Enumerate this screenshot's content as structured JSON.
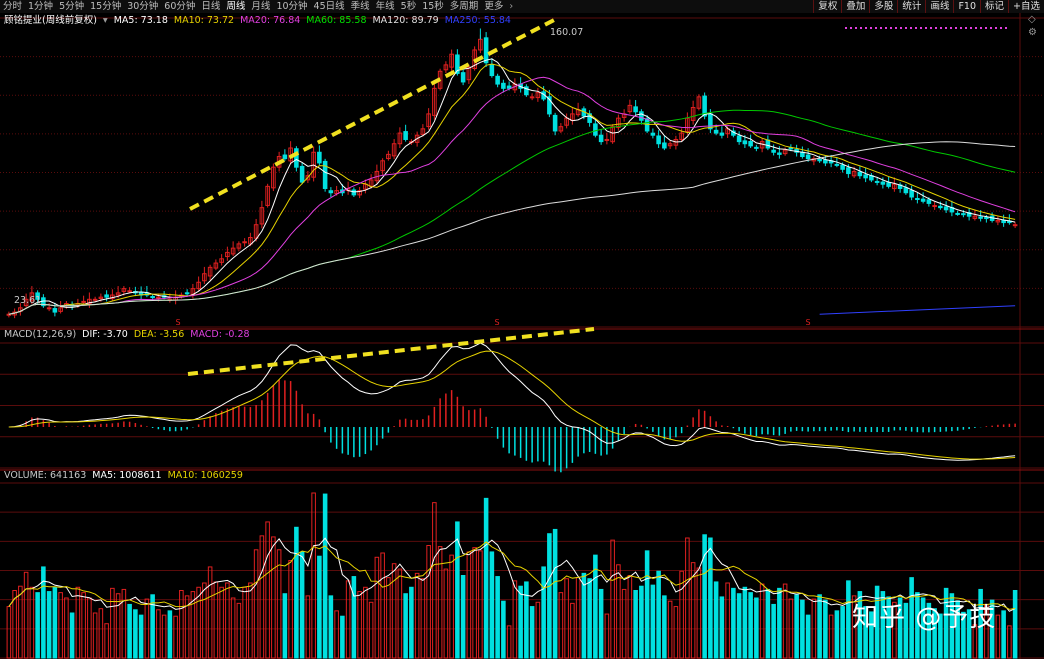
{
  "toolbar": {
    "tabs": [
      {
        "label": "分时"
      },
      {
        "label": "1分钟"
      },
      {
        "label": "5分钟"
      },
      {
        "label": "15分钟"
      },
      {
        "label": "30分钟"
      },
      {
        "label": "60分钟"
      },
      {
        "label": "日线"
      },
      {
        "label": "周线",
        "active": true
      },
      {
        "label": "月线"
      },
      {
        "label": "10分钟"
      },
      {
        "label": "45日线"
      },
      {
        "label": "季线"
      },
      {
        "label": "年线"
      },
      {
        "label": "5秒"
      },
      {
        "label": "15秒"
      },
      {
        "label": "多周期"
      },
      {
        "label": "更多"
      }
    ],
    "more_icon": "chevron-right-icon",
    "right_buttons": [
      {
        "label": "复权"
      },
      {
        "label": "叠加"
      },
      {
        "label": "多股"
      },
      {
        "label": "统计"
      },
      {
        "label": "画线"
      },
      {
        "label": "F10"
      },
      {
        "label": "标记"
      },
      {
        "label": "+自选"
      }
    ]
  },
  "price_panel": {
    "stock_name": "顾铭提业(周线前复权)",
    "ma_legend": [
      {
        "label": "MA5: 73.18",
        "color": "#ffffff"
      },
      {
        "label": "MA10: 73.72",
        "color": "#e6d200"
      },
      {
        "label": "MA20: 76.84",
        "color": "#e040e0"
      },
      {
        "label": "MA60: 85.58",
        "color": "#00e000"
      },
      {
        "label": "MA120: 89.79",
        "color": "#e0e0e0"
      },
      {
        "label": "MA250: 55.84",
        "color": "#3040ff"
      }
    ],
    "high_label": "160.07",
    "low_label": "23.61",
    "settings_icon": "gear-icon",
    "expand_icon": "diamond-icon"
  },
  "macd_panel": {
    "legend": [
      {
        "label": "MACD(12,26,9)",
        "color": "#c8c8c8"
      },
      {
        "label": "DIF: -3.70",
        "color": "#ffffff"
      },
      {
        "label": "DEA: -3.56",
        "color": "#e6d200"
      },
      {
        "label": "MACD: -0.28",
        "color": "#e040e0"
      }
    ]
  },
  "volume_panel": {
    "legend": [
      {
        "label": "VOLUME: 641163",
        "color": "#c8c8c8"
      },
      {
        "label": "MA5: 1008611",
        "color": "#ffffff"
      },
      {
        "label": "MA10: 1060259",
        "color": "#e6d200"
      }
    ]
  },
  "markers": [
    "S",
    "S",
    "S"
  ],
  "watermark": "知乎 @予技",
  "colors": {
    "up": "#e02020",
    "down": "#00e0e0",
    "ma5": "#ffffff",
    "ma10": "#e6d200",
    "ma20": "#e040e0",
    "ma60": "#00c800",
    "ma120": "#dcdcdc",
    "ma250": "#3040ff",
    "trend": "#f0e020",
    "grid": "#5a0c0c"
  },
  "chart_data": [
    {
      "type": "candlestick",
      "title": "",
      "x": [
        1,
        2,
        3,
        4,
        5,
        6,
        7,
        8,
        9,
        10,
        11,
        12,
        13,
        14,
        15,
        16,
        17,
        18,
        19,
        20,
        21,
        22,
        23,
        24,
        25,
        26,
        27,
        28,
        29,
        30,
        31,
        32,
        33,
        34,
        35,
        36,
        37,
        38,
        39,
        40,
        41,
        42,
        43,
        44,
        45,
        46,
        47,
        48,
        49,
        50,
        51,
        52,
        53,
        54,
        55,
        56,
        57,
        58,
        59,
        60,
        61,
        62,
        63,
        64,
        65,
        66,
        67,
        68,
        69,
        70,
        71,
        72,
        73,
        74,
        75,
        76,
        77,
        78,
        79,
        80,
        81,
        82,
        83,
        84,
        85,
        86,
        87,
        88,
        89,
        90,
        91,
        92,
        93,
        94,
        95,
        96,
        97,
        98,
        99,
        100,
        101,
        102,
        103,
        104,
        105,
        106,
        107,
        108,
        109,
        110,
        111,
        112,
        113,
        114,
        115,
        116,
        117,
        118,
        119,
        120,
        121,
        122,
        123,
        124,
        125,
        126,
        127,
        128,
        129,
        130,
        131,
        132,
        133,
        134,
        135,
        136,
        137,
        138,
        139,
        140,
        141,
        142,
        143,
        144,
        145,
        146,
        147,
        148,
        149,
        150,
        151,
        152,
        153,
        154,
        155,
        156,
        157,
        158,
        159,
        160,
        161,
        162,
        163,
        164,
        165,
        166,
        167,
        168,
        169,
        170,
        171,
        172,
        173,
        174,
        175,
        176
      ],
      "close": [
        26,
        27,
        29,
        33,
        36,
        33,
        30,
        29,
        27,
        29,
        31,
        30,
        31,
        32,
        33,
        33,
        34,
        34,
        35,
        36,
        38,
        37,
        36,
        35,
        35,
        34,
        34,
        34,
        33,
        34,
        35,
        36,
        38,
        41,
        45,
        48,
        50,
        52,
        55,
        57,
        59,
        60,
        62,
        68,
        76,
        86,
        95,
        100,
        99,
        104,
        95,
        88,
        91,
        102,
        97,
        85,
        83,
        84,
        83,
        85,
        82,
        84,
        87,
        89,
        93,
        98,
        101,
        106,
        111,
        108,
        107,
        110,
        113,
        120,
        132,
        140,
        143,
        148,
        139,
        135,
        142,
        150,
        155,
        144,
        138,
        134,
        132,
        132,
        134,
        132,
        129,
        128,
        130,
        127,
        120,
        112,
        114,
        118,
        120,
        122,
        119,
        116,
        110,
        107,
        108,
        114,
        118,
        120,
        124,
        121,
        117,
        112,
        110,
        106,
        104,
        106,
        108,
        111,
        118,
        123,
        128,
        119,
        113,
        111,
        110,
        113,
        110,
        107,
        106,
        105,
        104,
        107,
        104,
        102,
        101,
        103,
        104,
        102,
        100,
        99,
        99,
        98,
        97,
        97,
        96,
        94,
        92,
        93,
        91,
        90,
        89,
        88,
        87,
        86,
        87,
        85,
        83,
        81,
        80,
        79,
        78,
        77,
        76,
        75,
        74,
        73.18,
        73,
        72,
        72,
        71,
        71,
        70,
        70,
        69,
        69,
        68
      ],
      "ylim": [
        20,
        165
      ],
      "high_label": 160.07,
      "low_label": 23.61
    },
    {
      "type": "line",
      "title": "MACD(12,26,9)",
      "series": [
        {
          "name": "DIF",
          "last": -3.7
        },
        {
          "name": "DEA",
          "last": -3.56
        },
        {
          "name": "MACD",
          "last": -0.28
        }
      ]
    },
    {
      "type": "bar",
      "title": "VOLUME",
      "series": [
        {
          "name": "VOLUME",
          "last": 641163
        },
        {
          "name": "MA5",
          "last": 1008611
        },
        {
          "name": "MA10",
          "last": 1060259
        }
      ]
    }
  ]
}
